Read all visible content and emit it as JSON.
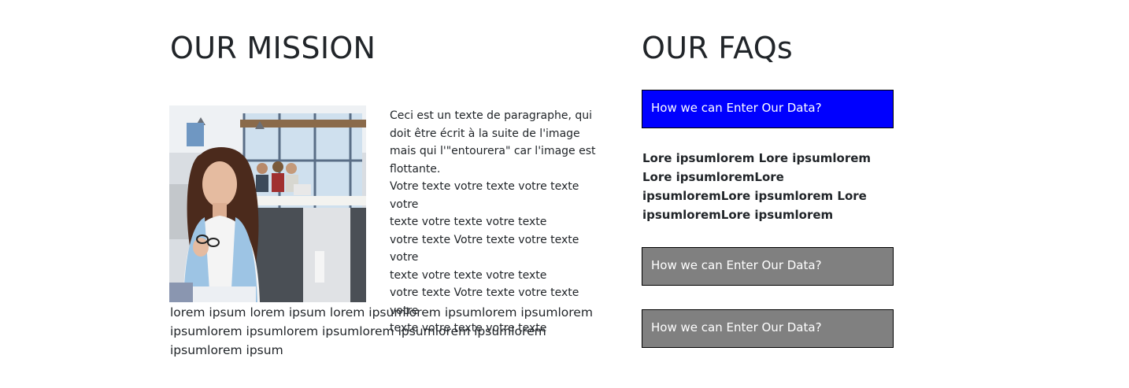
{
  "mission": {
    "title": "OUR MISSION",
    "paragraph_lines": [
      "Ceci est un texte de paragraphe, qui",
      "doit être écrit à la suite de l'image",
      "mais qui l'\"entourera\" car l'image est",
      "flottante.",
      "Votre texte votre texte votre texte votre",
      "texte votre texte votre texte",
      "votre texte Votre texte votre texte votre",
      "texte votre texte votre texte",
      "votre texte Votre texte votre texte votre",
      "texte votre texte votre texte"
    ],
    "lorem": "lorem ipsum lorem ipsum lorem ipsumlorem ipsumlorem ipsumlorem ipsumlorem ipsumlorem ipsumlorem ipsumlorem ipsumlorem ipsumlorem ipsum"
  },
  "faq": {
    "title": "OUR FAQs",
    "items": [
      {
        "question": "How we can Enter Our Data?",
        "color": "#0000ff",
        "expanded": true
      },
      {
        "question": "How we can Enter Our Data?",
        "color": "#808080",
        "expanded": false
      },
      {
        "question": "How we can Enter Our Data?",
        "color": "#808080",
        "expanded": false
      }
    ],
    "answer": "Lore ipsumlorem Lore ipsumlorem Lore ipsumloremLore ipsumloremLore ipsumlorem Lore ipsumloremLore ipsumlorem"
  }
}
